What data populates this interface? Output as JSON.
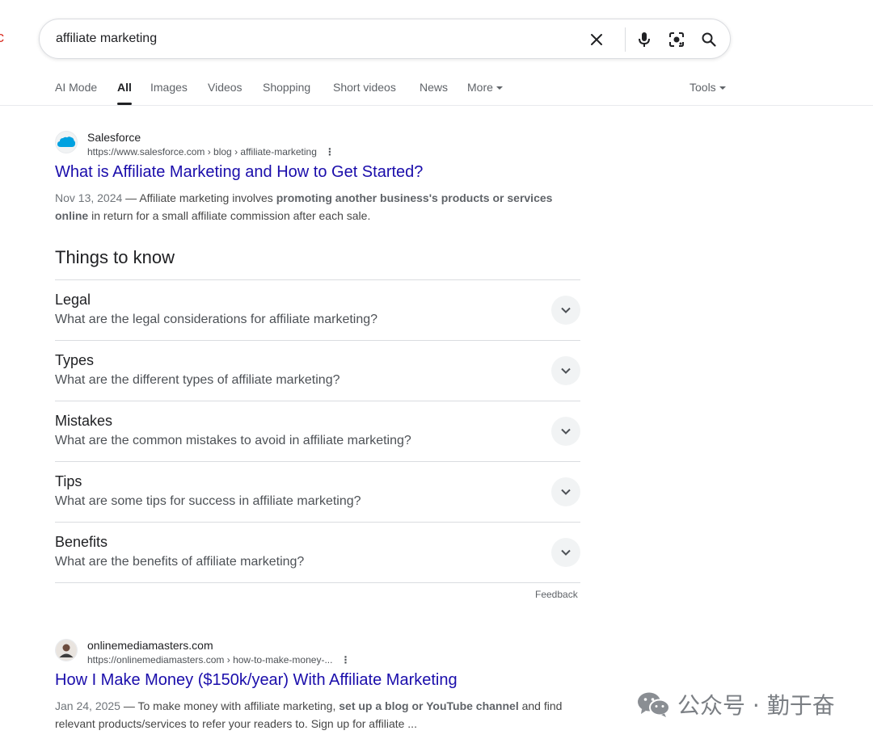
{
  "edge_glyph": "c",
  "search": {
    "value": "affiliate marketing"
  },
  "icons": {
    "clear": "close-icon",
    "mic": "microphone-icon",
    "lens": "camera-lens-icon",
    "search": "search-icon"
  },
  "tabs": [
    {
      "label": "AI Mode"
    },
    {
      "label": "All",
      "active": true
    },
    {
      "label": "Images"
    },
    {
      "label": "Videos"
    },
    {
      "label": "Shopping"
    },
    {
      "label": "Short videos"
    },
    {
      "label": "News"
    },
    {
      "label": "More"
    }
  ],
  "tools_label": "Tools",
  "results": [
    {
      "site": "Salesforce",
      "url": "https://www.salesforce.com › blog › affiliate-marketing",
      "title": "What is Affiliate Marketing and How to Get Started?",
      "date": "Nov 13, 2024",
      "sep": " — ",
      "snippet_a": "Affiliate marketing involves ",
      "snippet_bold": "promoting another business's products or services online",
      "snippet_b": " in return for a small affiliate commission after each sale."
    },
    {
      "site": "onlinemediamasters.com",
      "url": "https://onlinemediamasters.com › how-to-make-money-...",
      "title": "How I Make Money ($150k/year) With Affiliate Marketing",
      "date": "Jan 24, 2025",
      "sep": " — ",
      "snippet_a": "To make money with affiliate marketing, ",
      "snippet_bold": "set up a blog or YouTube channel",
      "snippet_b": " and find relevant products/services to refer your readers to. Sign up for affiliate ..."
    }
  ],
  "things_to_know": {
    "title": "Things to know",
    "items": [
      {
        "heading": "Legal",
        "question": "What are the legal considerations for affiliate marketing?"
      },
      {
        "heading": "Types",
        "question": "What are the different types of affiliate marketing?"
      },
      {
        "heading": "Mistakes",
        "question": "What are the common mistakes to avoid in affiliate marketing?"
      },
      {
        "heading": "Tips",
        "question": "What are some tips for success in affiliate marketing?"
      },
      {
        "heading": "Benefits",
        "question": "What are the benefits of affiliate marketing?"
      }
    ],
    "feedback": "Feedback"
  },
  "watermark": {
    "text": "公众号 · 勤于奋",
    "icon": "wechat-icon"
  },
  "colors": {
    "link": "#1a0dab",
    "salesforce_blue": "#00a1e0"
  }
}
